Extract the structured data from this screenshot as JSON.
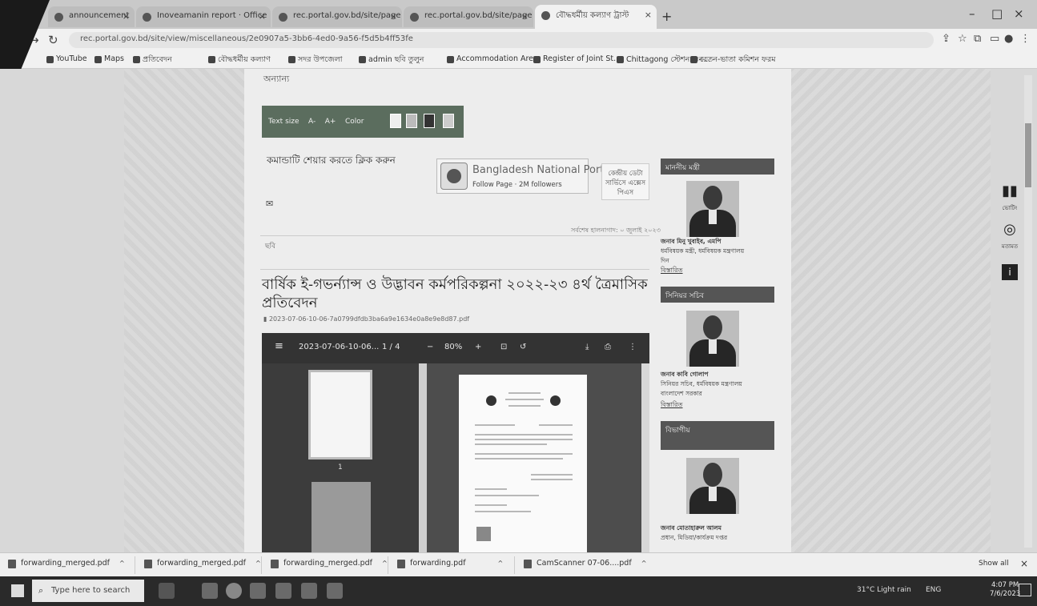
{
  "browser": {
    "tabs": [
      {
        "label": "announcement",
        "active": false
      },
      {
        "label": "Inoveamanin report · Office",
        "active": false
      },
      {
        "label": "rec.portal.gov.bd/site/page",
        "active": false
      },
      {
        "label": "rec.portal.gov.bd/site/page",
        "active": false
      },
      {
        "label": "বৌদ্ধধর্মীয় কল্যাণ ট্রাস্ট",
        "active": true
      }
    ],
    "new_tab": "+",
    "url": "rec.portal.gov.bd/site/view/miscellaneous/2e0907a5-3bb6-4ed0-9a56-f5d5b4ff53fe",
    "bookmarks": [
      "YouTube",
      "Maps",
      "প্রতিবেদন",
      "বৌদ্ধধর্মীয় কল্যাণ",
      "সদর উপজেলা",
      "admin ছবি তুলুন",
      "Accommodation Area",
      "Register of Joint St...",
      "Chittagong স্টেশন গুন...",
      "বেতন-ভাতা কমিশন ফরম"
    ]
  },
  "page": {
    "breadcrumb": "অন্যান্য",
    "access_toolbar": {
      "text_size": "Text size",
      "a_minus": "A-",
      "a_plus": "A+",
      "color": "Color"
    },
    "share_label": "কমান্ডাটি শেয়ার করতে ক্লিক করুন",
    "facebook_card": {
      "name": "Bangladesh National Portal",
      "follow": "Follow Page · 2M followers"
    },
    "side_button": "কেন্দ্রীয় ডেটা\nসার্ভিসে এক্সেস\nপিএস",
    "updated": "সর্বশেষ হালনাগাদ: ০ জুলাই ২০২৩",
    "note": "ছবি",
    "doc_title": "বার্ষিক ই-গভর্ন্যান্স ও উদ্ভাবন কর্মপরিকল্পনা ২০২২-২৩ ৪র্থ ত্রৈমাসিক প্রতিবেদন",
    "file_link": "2023-07-06-10-06-7a0799dfdb3ba6a9e1634e0a8e9e8d87.pdf"
  },
  "pdf_viewer": {
    "filename": "2023-07-06-10-06...",
    "page_info": "1 / 4",
    "zoom": "80%",
    "thumb_number": "1"
  },
  "sidebar": {
    "cards": [
      {
        "heading": "মাননীয় মন্ত্রী",
        "name": "জনাব মিনু খুবাইব, এমপি",
        "role": "ধর্মবিষয়ক মন্ত্রী, ধর্মবিষয়ক মন্ত্রণালয়",
        "extra": "দিন",
        "link": "বিস্তারিত"
      },
      {
        "heading": "সিনিয়র সচিব",
        "name": "জনাব কাবি গোলাপ",
        "role": "সিনিয়র সচিব, ধর্মবিষয়ক মন্ত্রণালয়",
        "extra": "বাংলাদেশ সরকার",
        "link": "বিস্তারিত"
      },
      {
        "heading": "বিভাগীয়",
        "name": "জনাব মোতাহারুল আলম",
        "role": "প্রধান, মিডিয়া/কার্যক্রম দপ্তর",
        "extra": "",
        "link": ""
      }
    ],
    "float_icons": [
      {
        "icon": "bar-chart-icon",
        "label": "ভোটিং"
      },
      {
        "icon": "chat-icon",
        "label": "মতামত"
      },
      {
        "icon": "info-icon",
        "label": ""
      }
    ]
  },
  "downloads": {
    "items": [
      "forwarding_merged.pdf",
      "forwarding_merged.pdf",
      "forwarding_merged.pdf",
      "forwarding.pdf",
      "CamScanner 07-06....pdf"
    ],
    "show_all": "Show all"
  },
  "taskbar": {
    "search_placeholder": "Type here to search",
    "weather": "31°C Light rain",
    "tray": "ENG",
    "time": "4:07 PM",
    "date": "7/6/2023"
  }
}
